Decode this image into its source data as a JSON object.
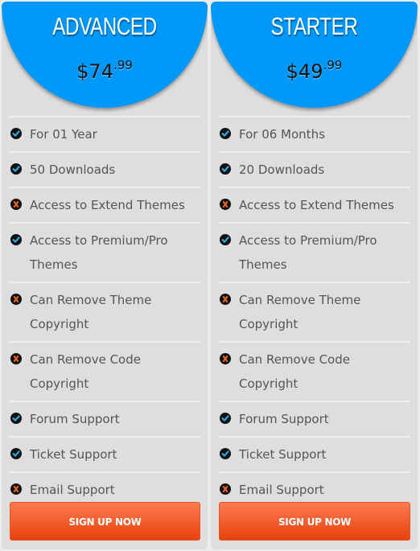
{
  "plans": [
    {
      "title": "ADVANCED",
      "price_main": "$74",
      "price_cents": ".99",
      "features": [
        {
          "text": "For 01 Year",
          "included": true
        },
        {
          "text": "50 Downloads",
          "included": true
        },
        {
          "text": "Access to Extend Themes",
          "included": false
        },
        {
          "text": "Access to Premium/Pro Themes",
          "included": true
        },
        {
          "text": "Can Remove Theme Copyright",
          "included": false
        },
        {
          "text": "Can Remove Code Copyright",
          "included": false
        },
        {
          "text": "Forum Support",
          "included": true
        },
        {
          "text": "Ticket Support",
          "included": true
        },
        {
          "text": "Email Support",
          "included": false
        }
      ],
      "button_label": "SIGN UP NOW"
    },
    {
      "title": "STARTER",
      "price_main": "$49",
      "price_cents": ".99",
      "features": [
        {
          "text": "For 06 Months",
          "included": true
        },
        {
          "text": "20 Downloads",
          "included": true
        },
        {
          "text": "Access to Extend Themes",
          "included": false
        },
        {
          "text": "Access to Premium/Pro Themes",
          "included": true
        },
        {
          "text": "Can Remove Theme Copyright",
          "included": false
        },
        {
          "text": "Can Remove Code Copyright",
          "included": false
        },
        {
          "text": "Forum Support",
          "included": true
        },
        {
          "text": "Ticket Support",
          "included": true
        },
        {
          "text": "Email Support",
          "included": false
        }
      ],
      "button_label": "SIGN UP NOW"
    }
  ],
  "colors": {
    "header_blue": "#0099fa",
    "check": "#2aa8e8",
    "cross": "#f26522",
    "button_top": "#fc7b52",
    "button_bottom": "#e8420d"
  },
  "icons": {
    "included": "check-circle-icon",
    "excluded": "x-circle-icon"
  }
}
